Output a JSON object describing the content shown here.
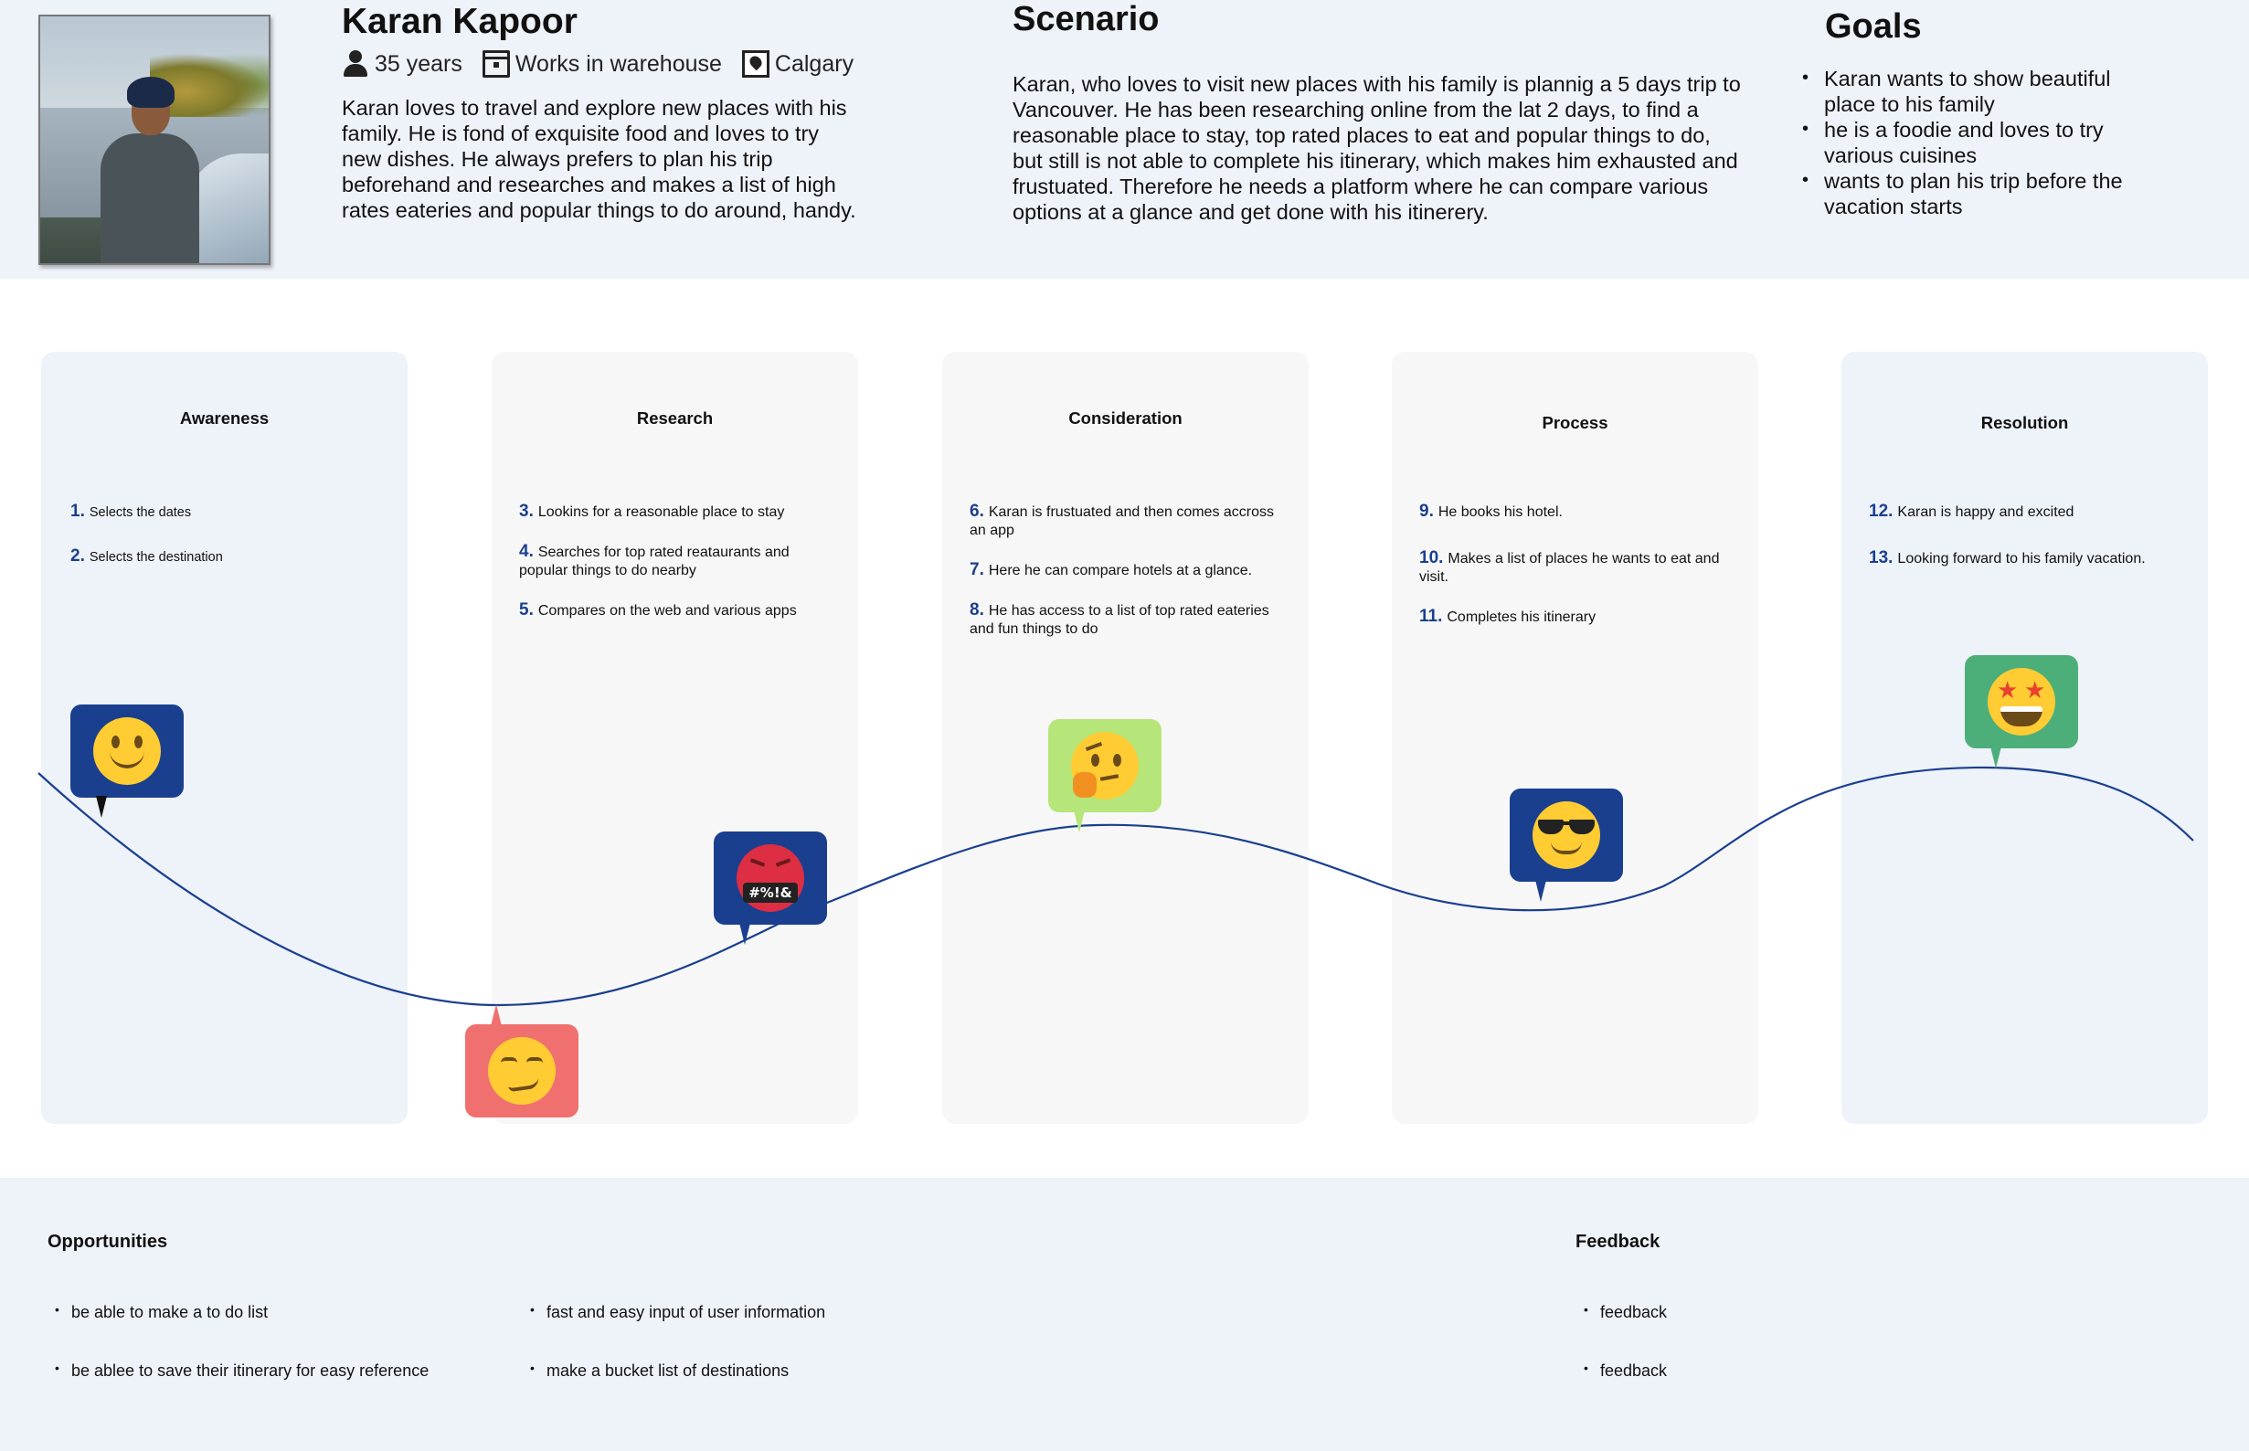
{
  "persona": {
    "name": "Karan Kapoor",
    "age": "35 years",
    "occupation": "Works in warehouse",
    "location": "Calgary",
    "bio": "Karan loves to travel and explore new places with his family. He is fond of exquisite food and loves to try new dishes. He always prefers to plan his trip beforehand and researches and makes a list of high rates eateries and popular things to do around, handy."
  },
  "scenario": {
    "title": "Scenario",
    "text": "Karan, who loves to visit new places with his family is plannig a 5 days trip to Vancouver. He has been researching online from the lat 2 days, to find a reasonable place to stay, top rated places to eat and popular things to do, but still is not able to complete his itinerary, which makes him exhausted and frustuated. Therefore he needs a platform where he can compare various options at a glance and get done with his itinerery."
  },
  "goals": {
    "title": "Goals",
    "items": [
      "Karan wants to show beautiful place to his family",
      "he is a foodie and loves to try various cuisines",
      "wants to plan his trip before the vacation starts"
    ]
  },
  "stages": [
    {
      "title": "Awareness",
      "steps": [
        {
          "num": "1.",
          "text": "Selects the dates"
        },
        {
          "num": "2.",
          "text": "Selects the destination"
        }
      ]
    },
    {
      "title": "Research",
      "steps": [
        {
          "num": "3.",
          "text": "Lookins for a reasonable place to stay"
        },
        {
          "num": "4.",
          "text": "Searches for top rated reataurants and popular things to do nearby"
        },
        {
          "num": "5.",
          "text": "Compares on the web and various apps"
        }
      ]
    },
    {
      "title": "Consideration",
      "steps": [
        {
          "num": "6.",
          "text": "Karan is frustuated and then comes accross an app"
        },
        {
          "num": "7.",
          "text": "Here he can compare hotels at a glance."
        },
        {
          "num": "8.",
          "text": "He has access to a list of top rated eateries and fun things to do"
        }
      ]
    },
    {
      "title": "Process",
      "steps": [
        {
          "num": "9.",
          "text": "He books his hotel."
        },
        {
          "num": "10.",
          "text": "Makes a list of places he wants to eat and visit."
        },
        {
          "num": "11.",
          "text": "Completes his itinerary"
        }
      ]
    },
    {
      "title": "Resolution",
      "steps": [
        {
          "num": "12.",
          "text": "Karan is happy and excited"
        },
        {
          "num": "13.",
          "text": "Looking forward to his family vacation."
        }
      ]
    }
  ],
  "emotions": [
    {
      "name": "smiling-face",
      "color": "#1a3f8f"
    },
    {
      "name": "smirking-face",
      "color": "#f07070"
    },
    {
      "name": "angry-swearing-face",
      "color": "#1a3f8f",
      "glyph_text": "#%!&"
    },
    {
      "name": "thinking-face",
      "color": "#b6e57a"
    },
    {
      "name": "sunglasses-face",
      "color": "#1a3f8f"
    },
    {
      "name": "star-struck-face",
      "color": "#4caf7a"
    }
  ],
  "opportunities": {
    "title": "Opportunities",
    "col1": [
      "be able to make a to do list",
      "be ablee to save their itinerary for easy reference"
    ],
    "col2": [
      "fast and easy input of user information",
      "make a bucket list of destinations"
    ]
  },
  "feedback": {
    "title": "Feedback",
    "items": [
      "feedback",
      "feedback"
    ]
  },
  "colors": {
    "header_bg": "#eef2f9",
    "accent_blue": "#1a3f8f",
    "curve": "#1a3f8f"
  }
}
